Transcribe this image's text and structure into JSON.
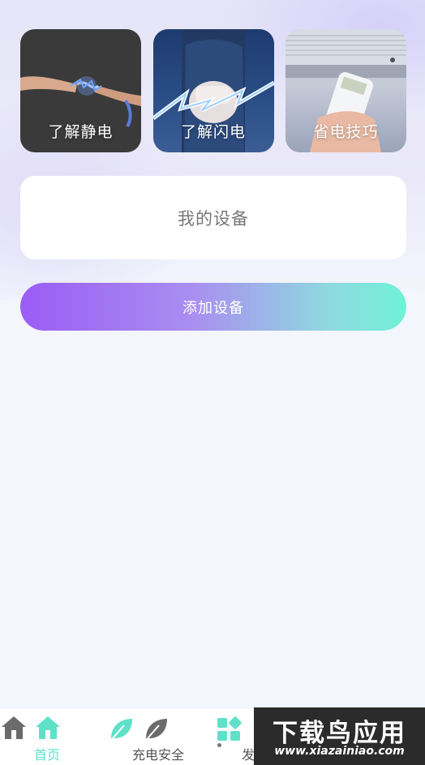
{
  "cards": [
    {
      "label": "了解静电",
      "icon": "static-electricity-photo"
    },
    {
      "label": "了解闪电",
      "icon": "lightning-fist-photo"
    },
    {
      "label": "省电技巧",
      "icon": "air-conditioner-remote-photo"
    }
  ],
  "devices_section": {
    "title": "我的设备"
  },
  "add_device_button": {
    "label": "添加设备"
  },
  "tabbar": {
    "items": [
      {
        "label": "首页",
        "icon": "home-icon",
        "active": true
      },
      {
        "label": "充电安全",
        "icon": "leaf-icon",
        "active": false
      },
      {
        "label": "发",
        "icon": "grid-icon",
        "active": false
      }
    ]
  },
  "watermark": {
    "title": "下载鸟应用",
    "url": "www.xiazainiao.com"
  },
  "colors": {
    "accent": "#5fe0c9",
    "button_gradient_start": "#9b5cf6",
    "button_gradient_end": "#6ff2d8"
  }
}
